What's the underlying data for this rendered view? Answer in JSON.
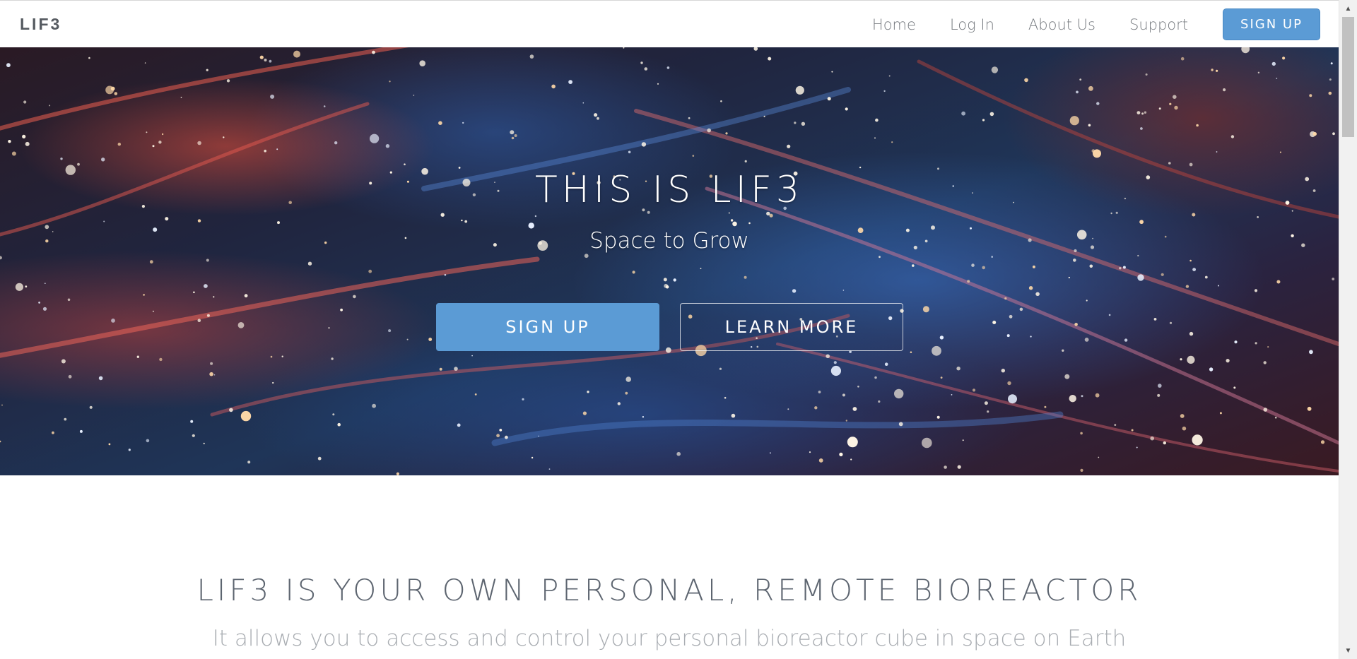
{
  "navbar": {
    "brand": "LIF3",
    "links": [
      "Home",
      "Log In",
      "About Us",
      "Support"
    ],
    "signup_label": "SIGN UP"
  },
  "hero": {
    "title": "THIS IS LIF3",
    "subtitle": "Space to Grow",
    "primary_button": "SIGN UP",
    "secondary_button": "LEARN MORE",
    "background": "nebula-starfield-image"
  },
  "section": {
    "title": "LIF3 IS YOUR OWN PERSONAL, REMOTE BIOREACTOR",
    "subtitle": "It allows you to access and control your personal bioreactor cube in space on Earth"
  },
  "colors": {
    "accent": "#5b9bd5",
    "nav_text": "#777b80",
    "heading_text": "#5d6570",
    "muted_text": "#a9adb2"
  }
}
